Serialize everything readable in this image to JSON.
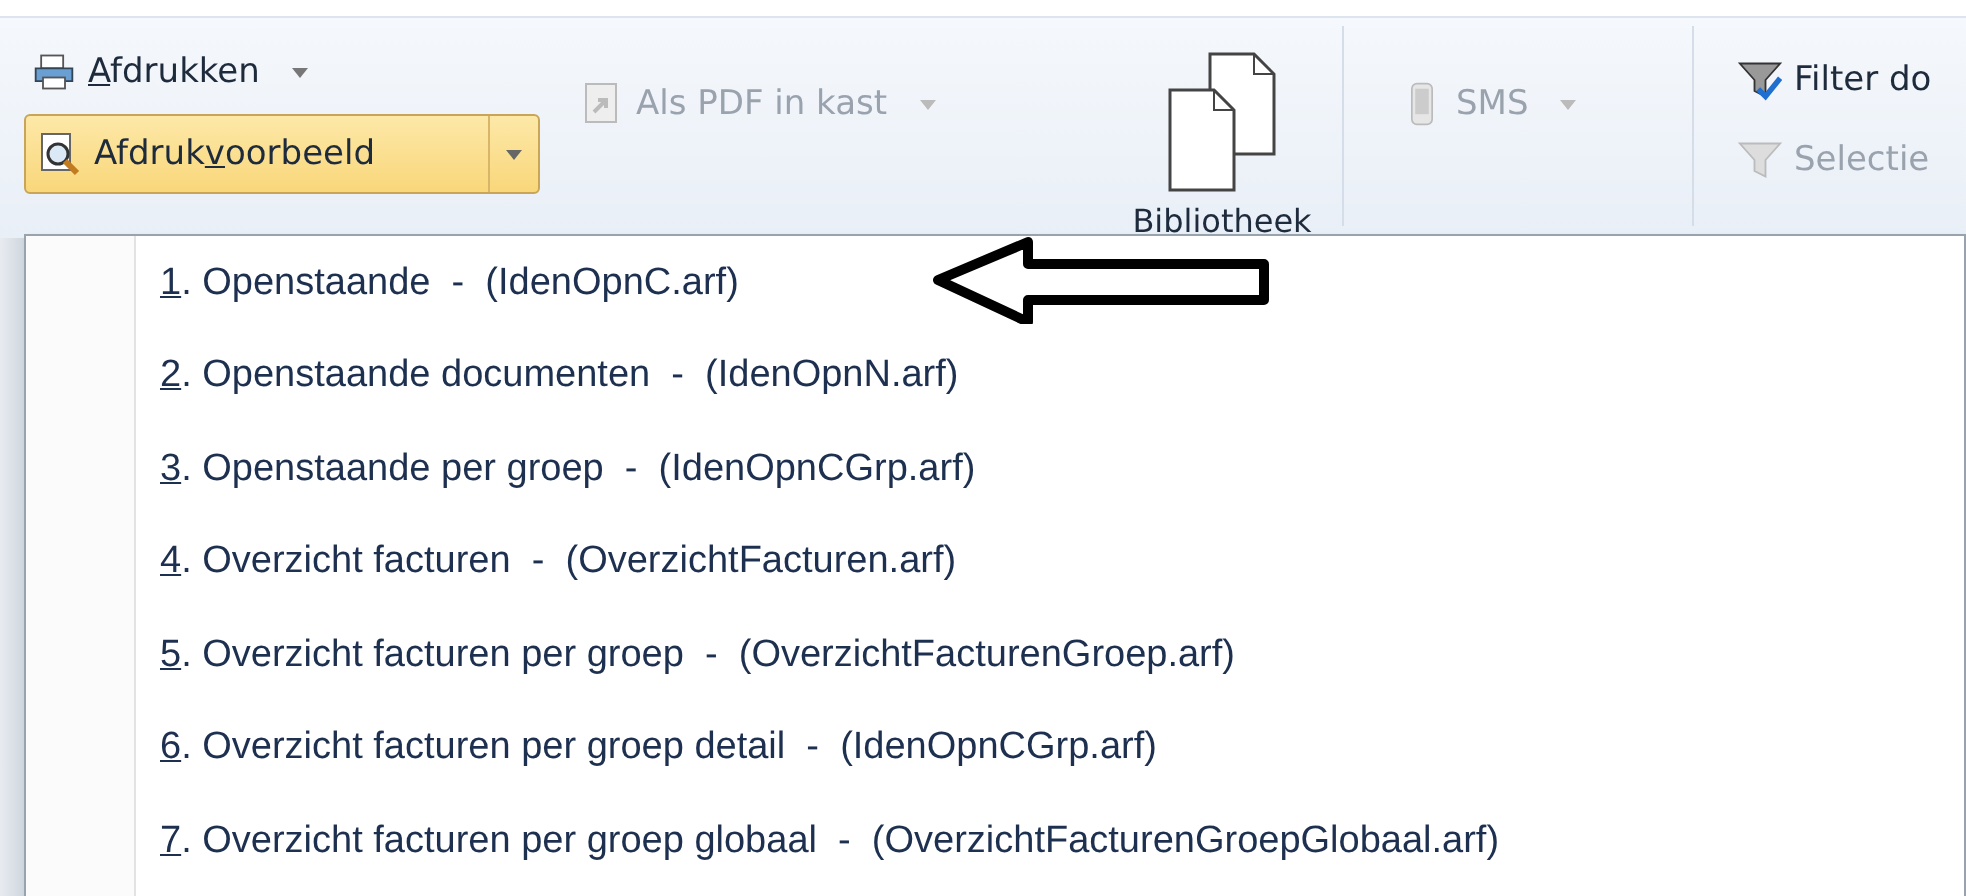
{
  "ribbon": {
    "print_button": {
      "key": "A",
      "after": "fdrukken"
    },
    "preview_button": {
      "before": "Afdruk",
      "key": "v",
      "after": "oorbeeld",
      "highlighted": true
    },
    "pdf_button": {
      "label": "Als PDF in kast",
      "disabled": true
    },
    "library_button": {
      "label": "Bibliotheek"
    },
    "sms_button": {
      "label": "SMS",
      "disabled": true
    },
    "filter_button": {
      "label": "Filter do",
      "disabled": false
    },
    "selection_button": {
      "label": "Selectie",
      "disabled": true
    }
  },
  "menu": {
    "items": [
      {
        "key": "1",
        "rest": ". Openstaande  -  (IdenOpnC.arf)",
        "selected": false
      },
      {
        "key": "2",
        "rest": ". Openstaande documenten  -  (IdenOpnN.arf)",
        "selected": false
      },
      {
        "key": "3",
        "rest": ". Openstaande per groep  -  (IdenOpnCGrp.arf)",
        "selected": false
      },
      {
        "key": "4",
        "rest": ". Overzicht facturen  -  (OverzichtFacturen.arf)",
        "selected": false
      },
      {
        "key": "5",
        "rest": ". Overzicht facturen per groep  -  (OverzichtFacturenGroep.arf)",
        "selected": false
      },
      {
        "key": "6",
        "rest": ". Overzicht facturen per groep detail  -  (IdenOpnCGrp.arf)",
        "selected": false
      },
      {
        "key": "7",
        "rest": ". Overzicht facturen per groep globaal  -  (OverzichtFacturenGroepGlobaal.arf)",
        "selected": false
      }
    ]
  }
}
